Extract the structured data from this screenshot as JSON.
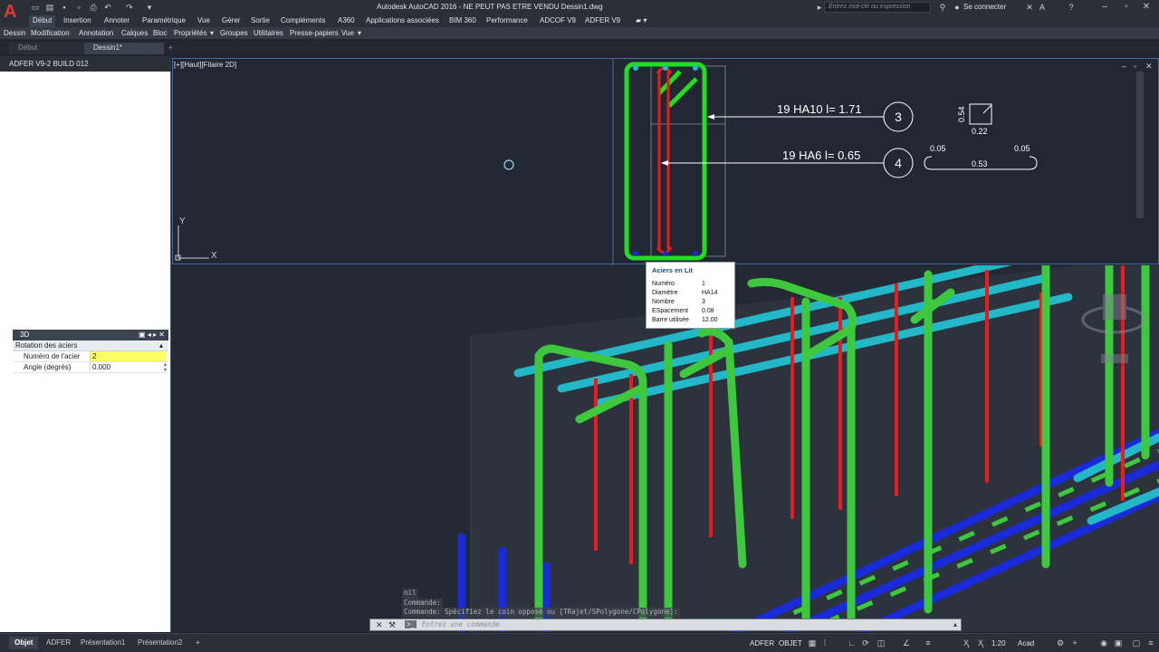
{
  "app": {
    "title": "Autodesk AutoCAD 2016 - NE PEUT PAS ETRE VENDU     Dessin1.dwg",
    "search_placeholder": "Entrez mot-clé ou expression",
    "signin": "Se connecter"
  },
  "ribbon_tabs": [
    "Début",
    "Insertion",
    "Annoter",
    "Paramétrique",
    "Vue",
    "Gérer",
    "Sortie",
    "Compléments",
    "A360",
    "Applications associées",
    "BIM 360",
    "Performance",
    "ADCOF V9",
    "ADFER V9"
  ],
  "panels": [
    "Dessin",
    "Modification",
    "Annotation",
    "Calques",
    "Bloc",
    "Propriétés",
    "Groupes",
    "Utilitaires",
    "Presse-papiers",
    "Vue"
  ],
  "file_tabs": [
    "Début",
    "Dessin1*"
  ],
  "left_panel": {
    "title": "ADFER V9-2 BUILD 012",
    "palette": {
      "title": "3D",
      "section": "Rotation des aciers",
      "rows": [
        {
          "label": "Numéro de l'acier",
          "value": "2"
        },
        {
          "label": "Angle (degrés)",
          "value": "0.000"
        }
      ]
    }
  },
  "viewport_top": {
    "label": "[+][Haut][Filaire 2D]",
    "axis_y": "Y",
    "axis_x": "X",
    "callouts": [
      {
        "text": "19 HA10  l= 1.71",
        "num": "3"
      },
      {
        "text": "19 HA6  l= 0.65",
        "num": "4"
      }
    ],
    "shape3": {
      "left": "0.54",
      "bottom": "0.22"
    },
    "shape4": {
      "hook_left": "0.05",
      "hook_right": "0.05",
      "length": "0.53"
    }
  },
  "tooltip": {
    "title": "Aciers en Lit",
    "rows": [
      {
        "k": "Numéro",
        "v": "1"
      },
      {
        "k": "Diamètre",
        "v": "HA14"
      },
      {
        "k": "Nombre",
        "v": "3"
      },
      {
        "k": "ESpacement",
        "v": "0.08"
      },
      {
        "k": "Barre utilisée",
        "v": "12.00"
      }
    ]
  },
  "command": {
    "history": [
      "nil",
      "Commande:",
      "Commande: Spécifiez le coin opposé ou [TRajet/SPolygone/CPolygone]:"
    ],
    "placeholder": "Entrez une commande"
  },
  "status": {
    "layout_tabs": [
      "Objet",
      "ADFER",
      "Présentation1",
      "Présentation2"
    ],
    "buttons": {
      "adfer": "ADFER",
      "objet": "OBJET",
      "scale": "1:20",
      "annot": "Acad"
    }
  },
  "colors": {
    "stirrup": "#22dd22",
    "bar_red": "#e81c1c",
    "bar_cyan": "#22b8c8",
    "bar_blue": "#1a2ad8",
    "bar_green": "#3ec83e"
  }
}
